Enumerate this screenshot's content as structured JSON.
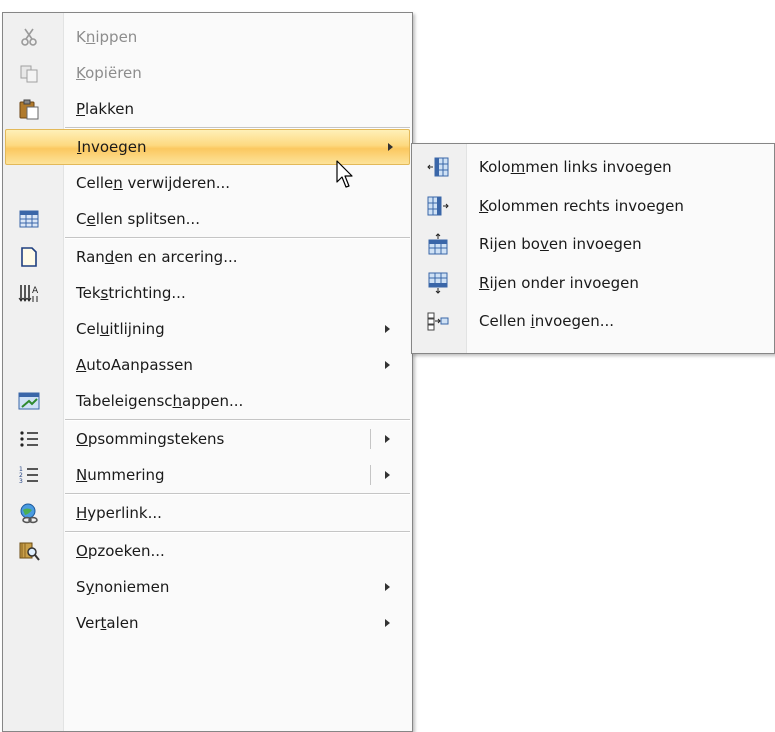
{
  "main_menu": {
    "items": [
      {
        "pre": "K",
        "key": "n",
        "post": "ippen",
        "icon": "scissors-icon",
        "disabled": true
      },
      {
        "pre": "",
        "key": "K",
        "post": "opiëren",
        "icon": "copy-icon",
        "disabled": true
      },
      {
        "pre": "",
        "key": "P",
        "post": "lakken",
        "icon": "paste-icon"
      },
      {
        "pre": "",
        "key": "I",
        "post": "nvoegen",
        "icon": "",
        "submenu": true,
        "highlighted": true
      },
      {
        "pre": "Celle",
        "key": "n",
        "post": " verwijderen...",
        "icon": ""
      },
      {
        "pre": "C",
        "key": "e",
        "post": "llen splitsen...",
        "icon": "split-cells-icon"
      },
      {
        "pre": "Ran",
        "key": "d",
        "post": "en en arcering...",
        "icon": "borders-shading-icon"
      },
      {
        "pre": "Tek",
        "key": "s",
        "post": "trichting...",
        "icon": "text-direction-icon"
      },
      {
        "pre": "Cel",
        "key": "u",
        "post": "itlijning",
        "icon": "",
        "submenu": true
      },
      {
        "pre": "",
        "key": "A",
        "post": "utoAanpassen",
        "icon": "",
        "submenu": true
      },
      {
        "pre": "Tabeleigensc",
        "key": "h",
        "post": "appen...",
        "icon": "table-properties-icon"
      },
      {
        "pre": "",
        "key": "O",
        "post": "psommingstekens",
        "icon": "bullets-icon",
        "submenu": true,
        "split": true
      },
      {
        "pre": "",
        "key": "N",
        "post": "ummering",
        "icon": "numbering-icon",
        "submenu": true,
        "split": true
      },
      {
        "pre": "",
        "key": "H",
        "post": "yperlink...",
        "icon": "hyperlink-icon"
      },
      {
        "pre": "",
        "key": "O",
        "post": "pzoeken...",
        "icon": "research-icon"
      },
      {
        "pre": "S",
        "key": "y",
        "post": "noniemen",
        "icon": "",
        "submenu": true
      },
      {
        "pre": "Ver",
        "key": "t",
        "post": "alen",
        "icon": "",
        "submenu": true
      }
    ]
  },
  "sub_menu": {
    "items": [
      {
        "pre": "Kolo",
        "key": "m",
        "post": "men links invoegen",
        "icon": "insert-columns-left-icon"
      },
      {
        "pre": "",
        "key": "K",
        "post": "olommen rechts invoegen",
        "icon": "insert-columns-right-icon"
      },
      {
        "pre": "Rijen bo",
        "key": "v",
        "post": "en invoegen",
        "icon": "insert-rows-above-icon"
      },
      {
        "pre": "",
        "key": "R",
        "post": "ijen onder invoegen",
        "icon": "insert-rows-below-icon"
      },
      {
        "pre": "Cellen ",
        "key": "i",
        "post": "nvoegen...",
        "icon": "insert-cells-icon"
      }
    ]
  }
}
